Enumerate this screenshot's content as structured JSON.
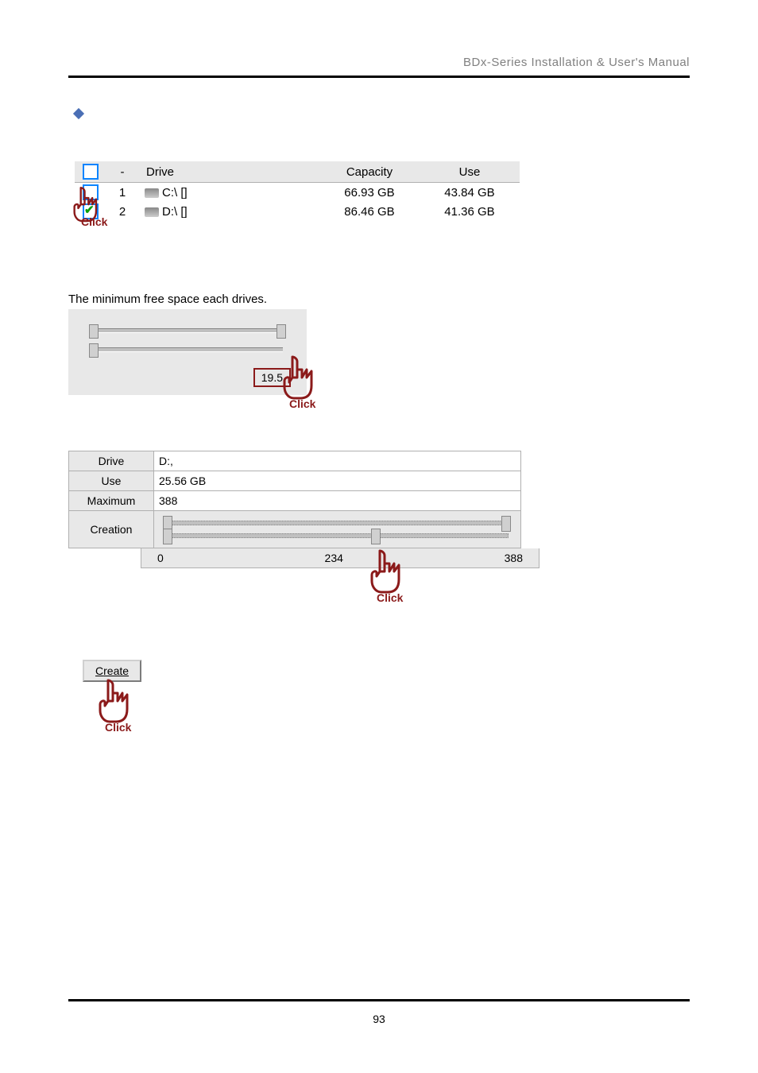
{
  "header": "BDx-Series Installation & User's Manual",
  "driveTable": {
    "headers": {
      "dash": "-",
      "drive": "Drive",
      "capacity": "Capacity",
      "use": "Use"
    },
    "rows": [
      {
        "num": "1",
        "drive": "C:\\ []",
        "capacity": "66.93 GB",
        "use": "43.84 GB",
        "checked": false
      },
      {
        "num": "2",
        "drive": "D:\\ []",
        "capacity": "86.46 GB",
        "use": "41.36 GB",
        "checked": true
      }
    ]
  },
  "minSpaceLabel": "The minimum free space each drives.",
  "minSpaceValue": "19.5",
  "infoTable": {
    "driveLabel": "Drive",
    "driveValue": "D:,",
    "useLabel": "Use",
    "useValue": "25.56 GB",
    "maxLabel": "Maximum",
    "maxValue": "388",
    "creationLabel": "Creation"
  },
  "scale": {
    "min": "0",
    "mid": "234",
    "max": "388"
  },
  "createLabel": "Create",
  "createAccessKey": "C",
  "clickLabel": "Click",
  "pageNumber": "93"
}
